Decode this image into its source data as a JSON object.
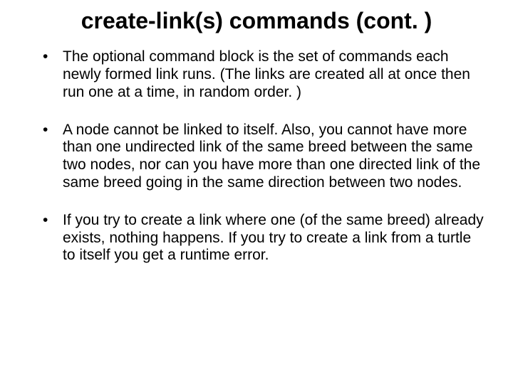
{
  "title": "create-link(s) commands (cont. )",
  "bullets": [
    "The optional command block is the set of commands each newly formed link runs. (The links are created all at once then run one at a time, in random order. )",
    "A node cannot be linked to itself. Also, you cannot have more than one undirected link of the same breed between the same two nodes, nor can you have more than one directed link of the same breed going in the same direction between two nodes.",
    "If you try to create a link where one (of the same breed) already exists, nothing happens. If you try to create a link from a turtle to itself you get a runtime error."
  ]
}
